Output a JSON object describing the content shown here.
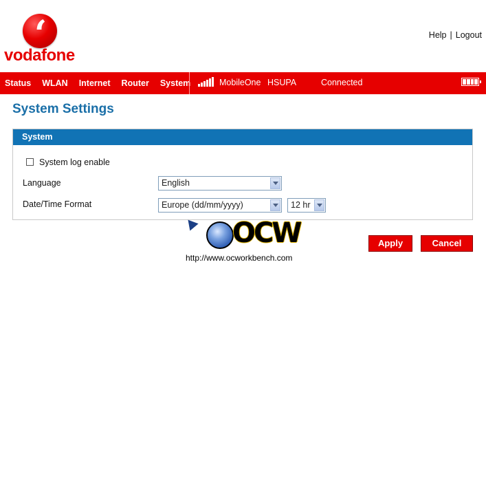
{
  "brand": {
    "name": "vodafone",
    "accent_color": "#e60000"
  },
  "top_links": {
    "help": "Help",
    "separator": "|",
    "logout": "Logout"
  },
  "nav": {
    "items": [
      {
        "label": "Status"
      },
      {
        "label": "WLAN"
      },
      {
        "label": "Internet"
      },
      {
        "label": "Router"
      },
      {
        "label": "System"
      }
    ],
    "signal_icon": "signal-bars-icon",
    "carrier": "MobileOne",
    "network_type": "HSUPA",
    "connection_status": "Connected",
    "battery_icon": "battery-icon"
  },
  "page": {
    "title": "System Settings",
    "title_color": "#1a6fa8"
  },
  "panel": {
    "header": "System",
    "header_color": "#1173b5",
    "system_log": {
      "label": "System log enable",
      "checked": false
    },
    "language": {
      "label": "Language",
      "value": "English"
    },
    "datetime_format": {
      "label": "Date/Time Format",
      "date_value": "Europe (dd/mm/yyyy)",
      "time_value": "12 hr"
    }
  },
  "watermark": {
    "logo_text": "OCW",
    "url": "http://www.ocworkbench.com"
  },
  "actions": {
    "apply": "Apply",
    "cancel": "Cancel"
  }
}
